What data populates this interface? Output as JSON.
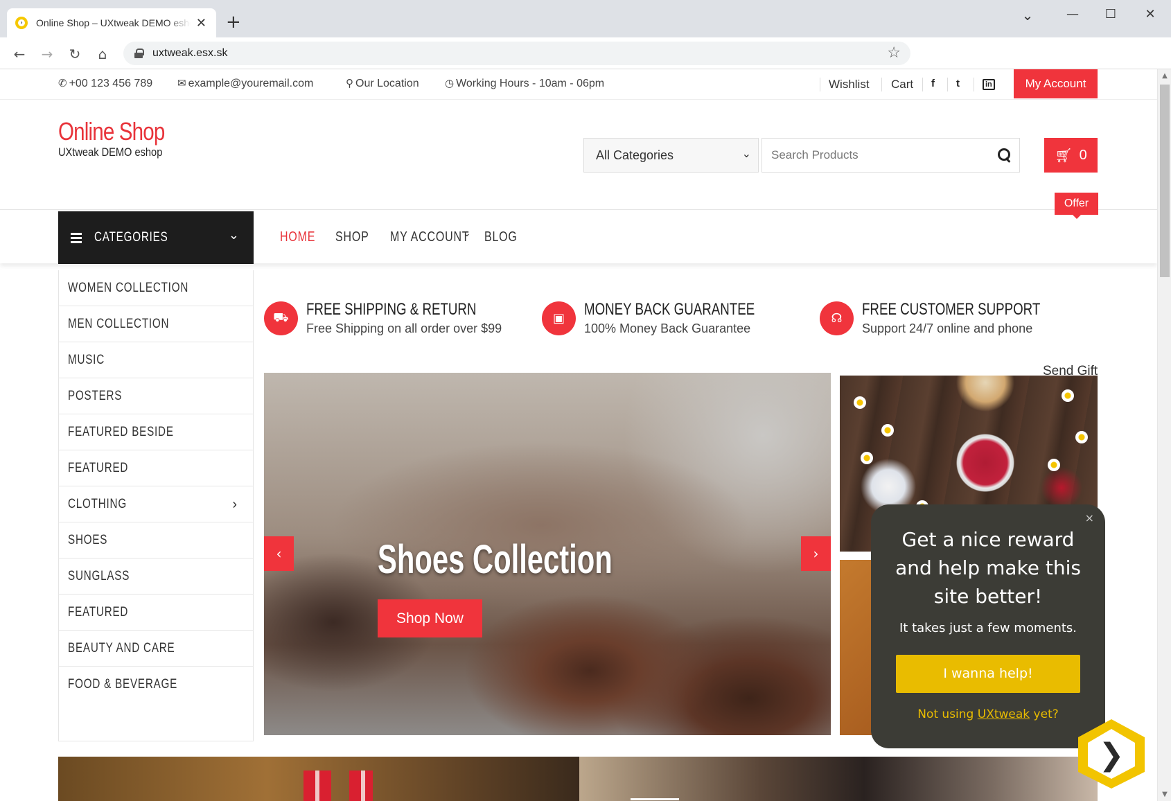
{
  "browser": {
    "tab_title": "Online Shop – UXtweak DEMO eshop",
    "tab_close": "✕",
    "new_tab": "+",
    "url": "uxtweak.esx.sk",
    "controls": {
      "minimize": "—",
      "maximize": "☐",
      "close": "✕",
      "tab_search": "⌄"
    },
    "nav": {
      "back": "←",
      "forward": "→",
      "reload": "↻",
      "home": "⌂",
      "bookmark": "☆"
    }
  },
  "topbar": {
    "phone": "+00 123 456 789",
    "email": "example@youremail.com",
    "location": "Our Location",
    "hours": "Working Hours - 10am - 06pm",
    "wishlist": "Wishlist",
    "cart": "Cart",
    "social": {
      "facebook": "f",
      "twitter": "t",
      "linkedin": "in"
    },
    "my_account": "My Account"
  },
  "header": {
    "brand_name": "Online Shop",
    "brand_sub": "UXtweak DEMO eshop",
    "category_select": "All Categories",
    "search_placeholder": "Search Products",
    "cart_count": "0"
  },
  "nav": {
    "categories_label": "CATEGORIES",
    "items": [
      {
        "label": "HOME",
        "active": true
      },
      {
        "label": "SHOP"
      },
      {
        "label": "MY ACCOUNT",
        "has_dropdown": true
      },
      {
        "label": "BLOG"
      }
    ],
    "offer": "Offer",
    "send_gift": "Send Gift"
  },
  "sidebar": {
    "items": [
      {
        "label": "WOMEN COLLECTION"
      },
      {
        "label": "MEN COLLECTION"
      },
      {
        "label": "MUSIC"
      },
      {
        "label": "POSTERS"
      },
      {
        "label": "FEATURED BESIDE"
      },
      {
        "label": "FEATURED"
      },
      {
        "label": "CLOTHING",
        "arrow": "›"
      },
      {
        "label": "SHOES"
      },
      {
        "label": "SUNGLASS"
      },
      {
        "label": "FEATURED"
      },
      {
        "label": "BEAUTY AND CARE"
      },
      {
        "label": "FOOD & BEVERAGE"
      }
    ]
  },
  "features": [
    {
      "title": "FREE SHIPPING & RETURN",
      "subtitle": "Free Shipping on all order over $99",
      "icon": "truck-icon"
    },
    {
      "title": "MONEY BACK GUARANTEE",
      "subtitle": "100% Money Back Guarantee",
      "icon": "money-icon"
    },
    {
      "title": "FREE CUSTOMER SUPPORT",
      "subtitle": "Support 24/7 online and phone",
      "icon": "headset-icon"
    }
  ],
  "hero": {
    "title": "Shoes Collection",
    "button": "Shop Now",
    "prev": "‹",
    "next": "›"
  },
  "popup": {
    "title": "Get a nice reward and help make this site better!",
    "subtitle": "It takes just a few moments.",
    "button": "I wanna help!",
    "footer_prefix": "Not using ",
    "footer_link": "UXtweak",
    "footer_suffix": " yet?",
    "close": "×"
  },
  "colors": {
    "accent": "#f0343c",
    "dark": "#1d1d1d",
    "popup_bg": "#3c3c36",
    "popup_accent": "#e9bc00"
  }
}
